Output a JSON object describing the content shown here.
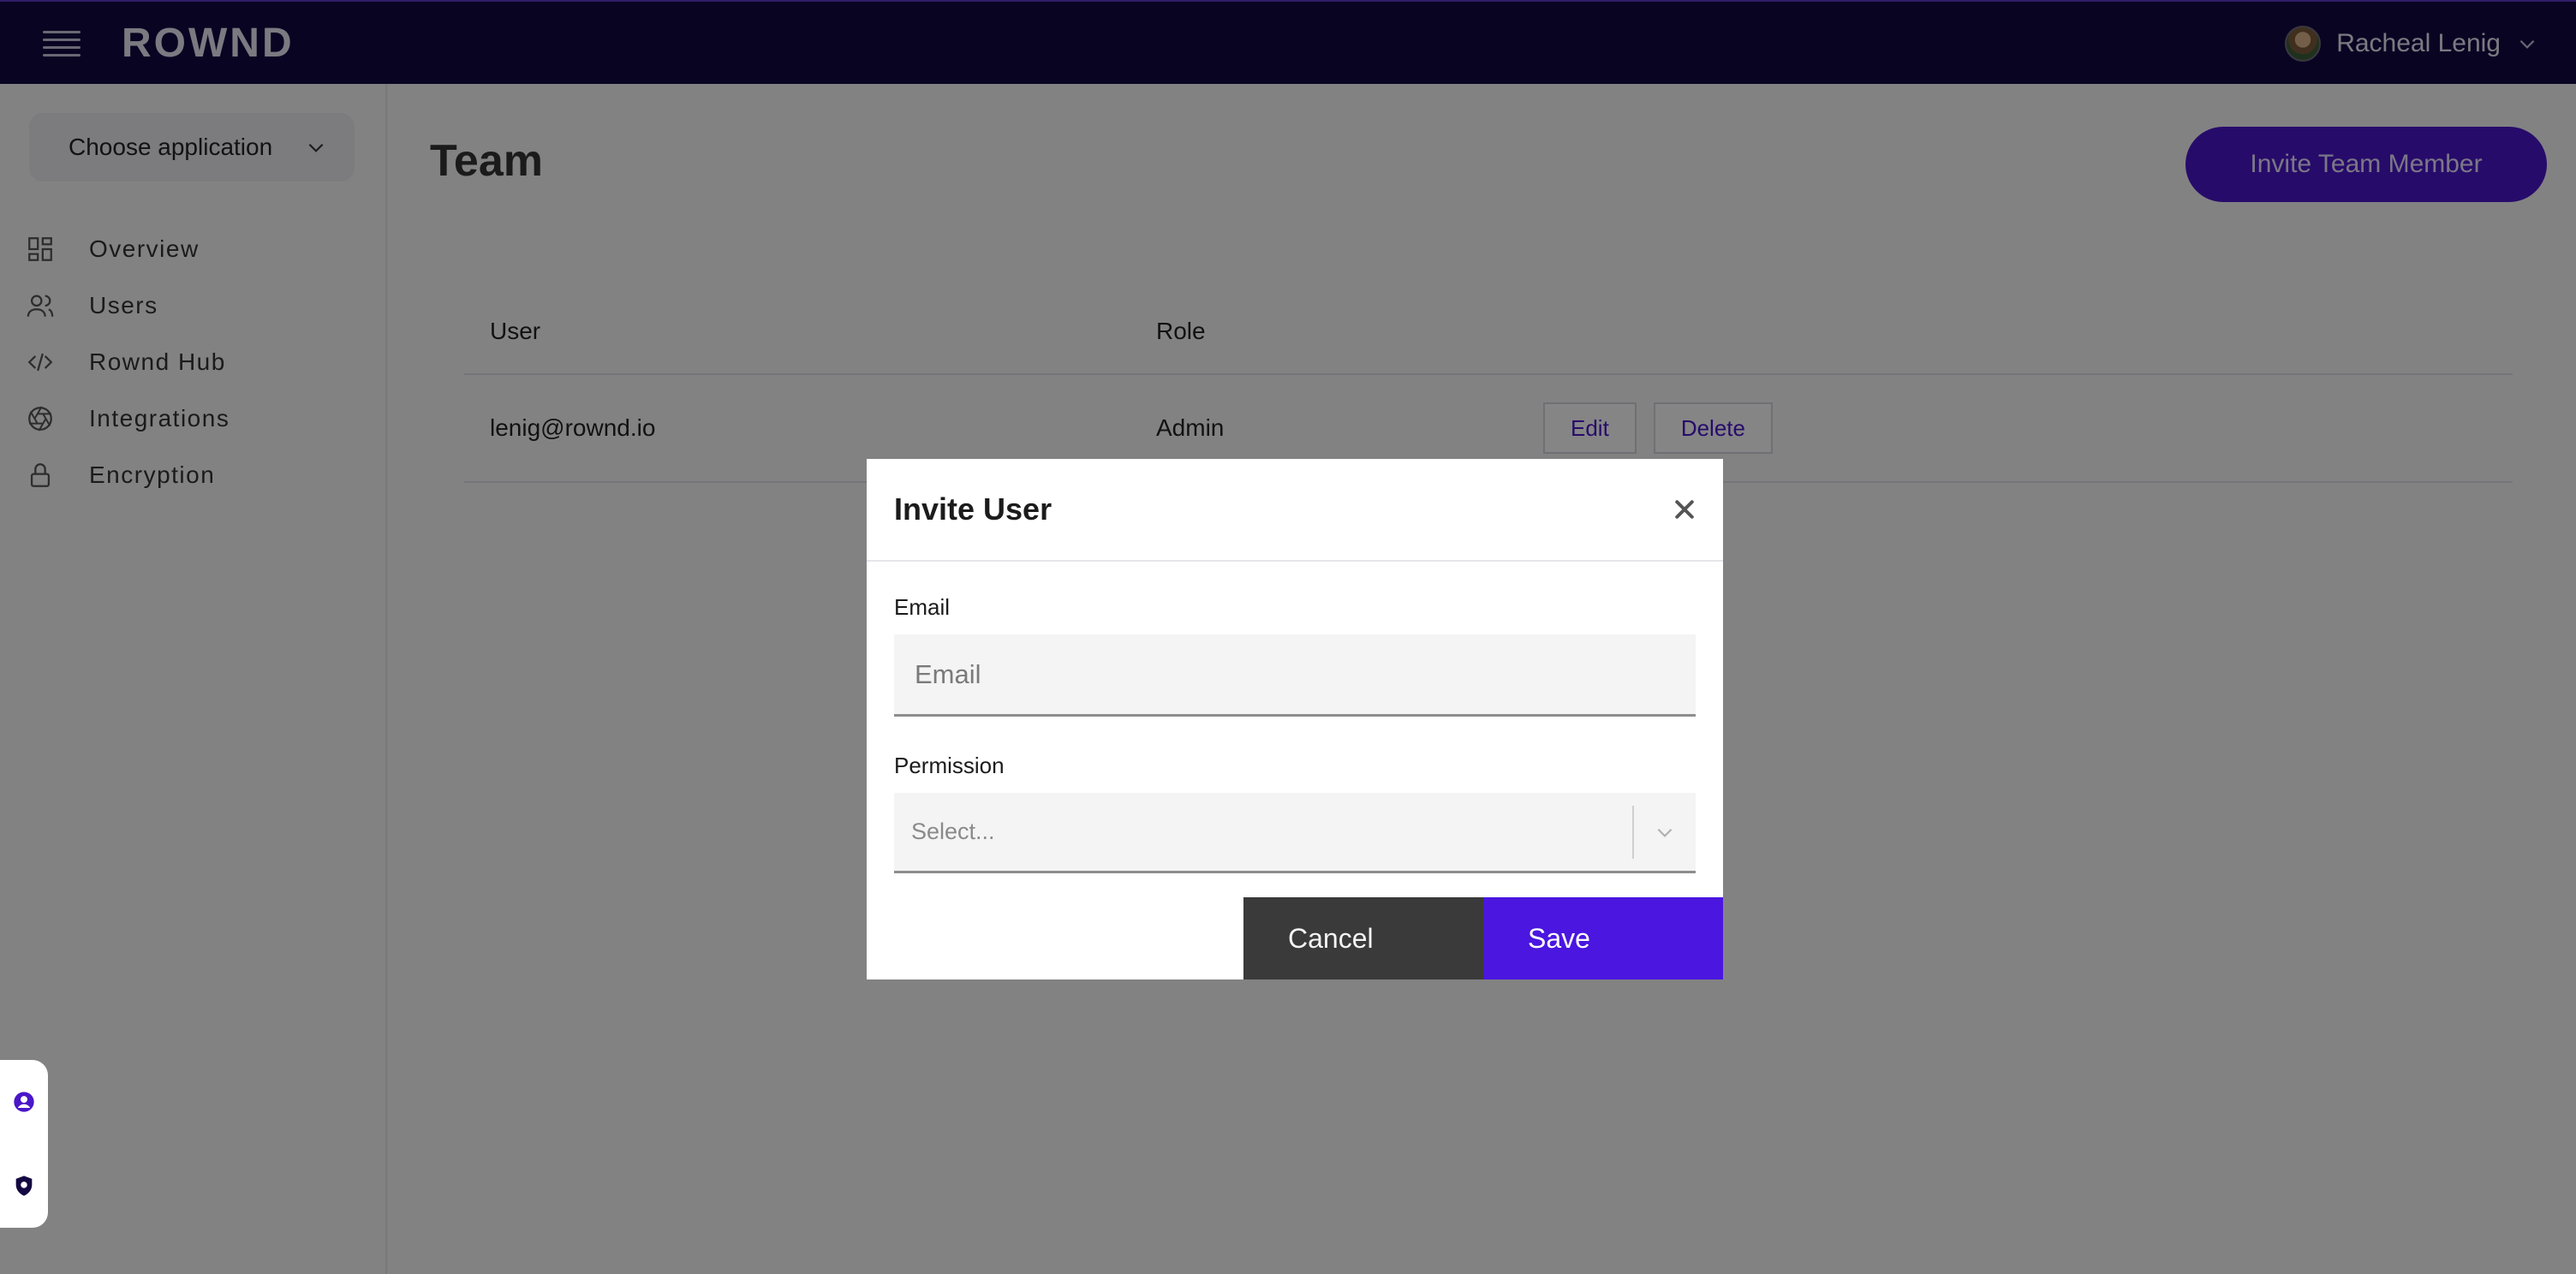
{
  "header": {
    "logo": "ROWND",
    "user_name": "Racheal Lenig"
  },
  "sidebar": {
    "app_select_label": "Choose application",
    "items": [
      {
        "label": "Overview",
        "icon": "dashboard-icon"
      },
      {
        "label": "Users",
        "icon": "users-icon"
      },
      {
        "label": "Rownd Hub",
        "icon": "code-icon"
      },
      {
        "label": "Integrations",
        "icon": "aperture-icon"
      },
      {
        "label": "Encryption",
        "icon": "lock-icon"
      }
    ]
  },
  "main": {
    "title": "Team",
    "invite_button": "Invite Team Member",
    "table": {
      "columns": [
        "User",
        "Role"
      ],
      "rows": [
        {
          "user": "lenig@rownd.io",
          "role": "Admin",
          "actions": [
            "Edit",
            "Delete"
          ]
        }
      ]
    }
  },
  "modal": {
    "title": "Invite User",
    "email_label": "Email",
    "email_placeholder": "Email",
    "email_value": "",
    "permission_label": "Permission",
    "permission_placeholder": "Select...",
    "cancel_label": "Cancel",
    "save_label": "Save"
  },
  "colors": {
    "topbar": "#140842",
    "accent": "#4a16c9",
    "save": "#4a16e0",
    "cancel": "#3a3a3a"
  }
}
